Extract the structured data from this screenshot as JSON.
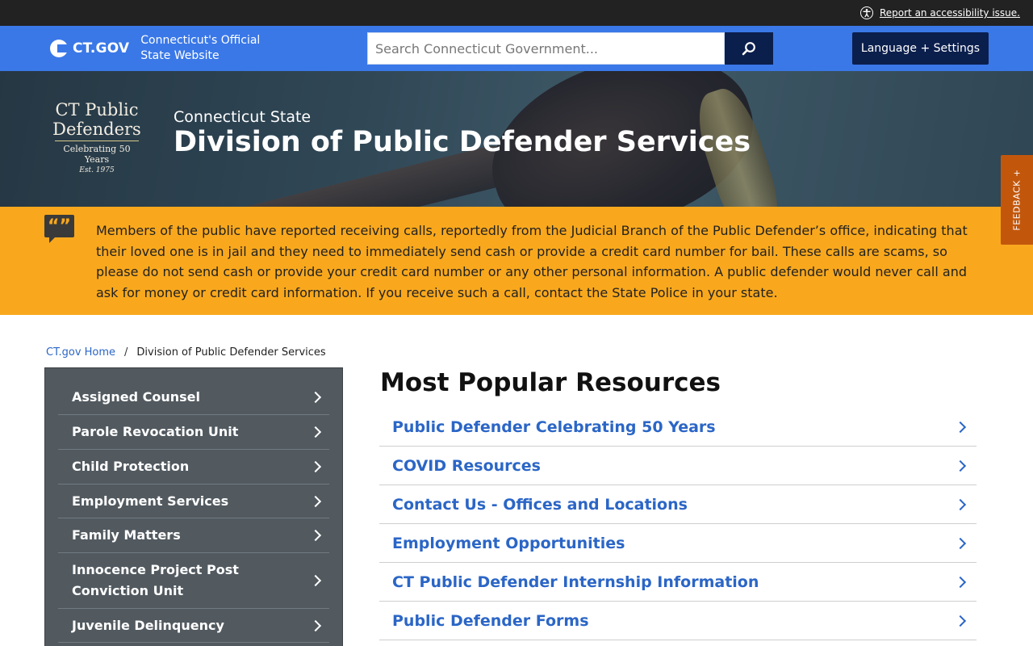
{
  "utility": {
    "accessibility_link": "Report an accessibility issue."
  },
  "header": {
    "logo_text": "CT.GOV",
    "tagline_line1": "Connecticut's Official",
    "tagline_line2": "State Website",
    "search_placeholder": "Search Connecticut Government...",
    "language_button": "Language + Settings",
    "accent_color": "#3a78e8",
    "dark_color": "#0b1f4d"
  },
  "hero": {
    "logo_line1": "CT Public",
    "logo_line2": "Defenders",
    "logo_line3": "Celebrating 50 Years",
    "logo_line4": "Est. 1975",
    "kicker": "Connecticut State",
    "title": "Division of Public Defender Services"
  },
  "alert": {
    "icon": "quote-bubble-icon",
    "text": "Members of the public have reported receiving calls, reportedly from the Judicial Branch of the Public Defender’s office, indicating that their loved one is in jail and they need to immediately send cash or provide a credit card number for bail. These calls are scams, so please do not send cash or provide your credit card number or any other personal information. A public defender would never call and ask for money or credit card information. If you receive such a call, contact the State Police in your state.",
    "color": "#f9a81d"
  },
  "breadcrumb": {
    "home": "CT.gov Home",
    "separator": "/",
    "current": "Division of Public Defender Services"
  },
  "sidebar": {
    "items": [
      {
        "label": "Assigned Counsel"
      },
      {
        "label": "Parole Revocation Unit"
      },
      {
        "label": "Child Protection"
      },
      {
        "label": "Employment Services"
      },
      {
        "label": "Family Matters"
      },
      {
        "label": "Innocence Project Post Conviction Unit"
      },
      {
        "label": "Juvenile Delinquency"
      }
    ]
  },
  "main": {
    "title": "Most Popular Resources",
    "resources": [
      {
        "label": "Public Defender Celebrating 50 Years"
      },
      {
        "label": "COVID Resources"
      },
      {
        "label": "Contact Us - Offices and Locations"
      },
      {
        "label": "Employment Opportunities"
      },
      {
        "label": "CT Public Defender Internship Information"
      },
      {
        "label": "Public Defender Forms"
      }
    ]
  },
  "feedback": {
    "label": "FEEDBACK +"
  }
}
